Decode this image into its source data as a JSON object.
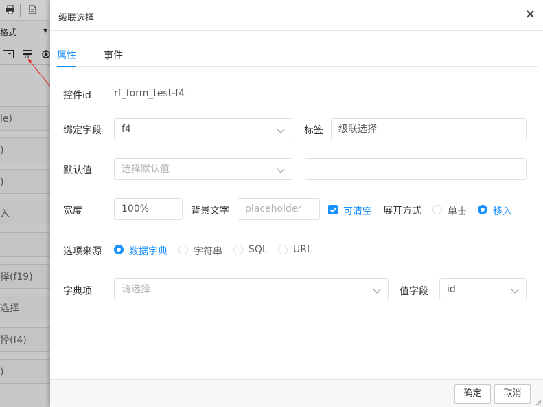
{
  "background": {
    "format_label": "格式",
    "list_items": [
      "le)",
      ")",
      ")",
      "入",
      "",
      "择(f19)",
      "选择",
      "择(f4)",
      ")"
    ]
  },
  "dialog": {
    "title": "级联选择",
    "close_glyph": "×",
    "tabs": [
      {
        "label": "属性",
        "active": true
      },
      {
        "label": "事件",
        "active": false
      }
    ],
    "control_id_label": "控件id",
    "control_id_value": "rf_form_test-f4",
    "bind_field_label": "绑定字段",
    "bind_field_value": "f4",
    "tag_label": "标签",
    "tag_value": "级联选择",
    "default_label": "默认值",
    "default_placeholder": "选择默认值",
    "default_extra_value": "",
    "width_label": "宽度",
    "width_value": "100%",
    "bg_text_label": "背景文字",
    "bg_text_placeholder": "placeholder",
    "clearable_label": "可清空",
    "clearable_checked": true,
    "expand_label": "展开方式",
    "expand_options": [
      {
        "label": "单击",
        "selected": false
      },
      {
        "label": "移入",
        "selected": true
      }
    ],
    "source_label": "选项来源",
    "source_options": [
      {
        "label": "数据字典",
        "selected": true
      },
      {
        "label": "字符串",
        "selected": false
      },
      {
        "label": "SQL",
        "selected": false
      },
      {
        "label": "URL",
        "selected": false
      }
    ],
    "dict_label": "字典项",
    "dict_placeholder": "请选择",
    "value_field_label": "值字段",
    "value_field_value": "id",
    "confirm_label": "确定",
    "cancel_label": "取消"
  },
  "colors": {
    "accent": "#1890ff",
    "overlay": "#8a8a8a"
  },
  "icons": [
    "print-icon",
    "document-icon",
    "dropdown-icon",
    "cascade-select-icon",
    "radio-icon",
    "close-icon",
    "chevron-down-icon",
    "resize-grip-icon"
  ]
}
